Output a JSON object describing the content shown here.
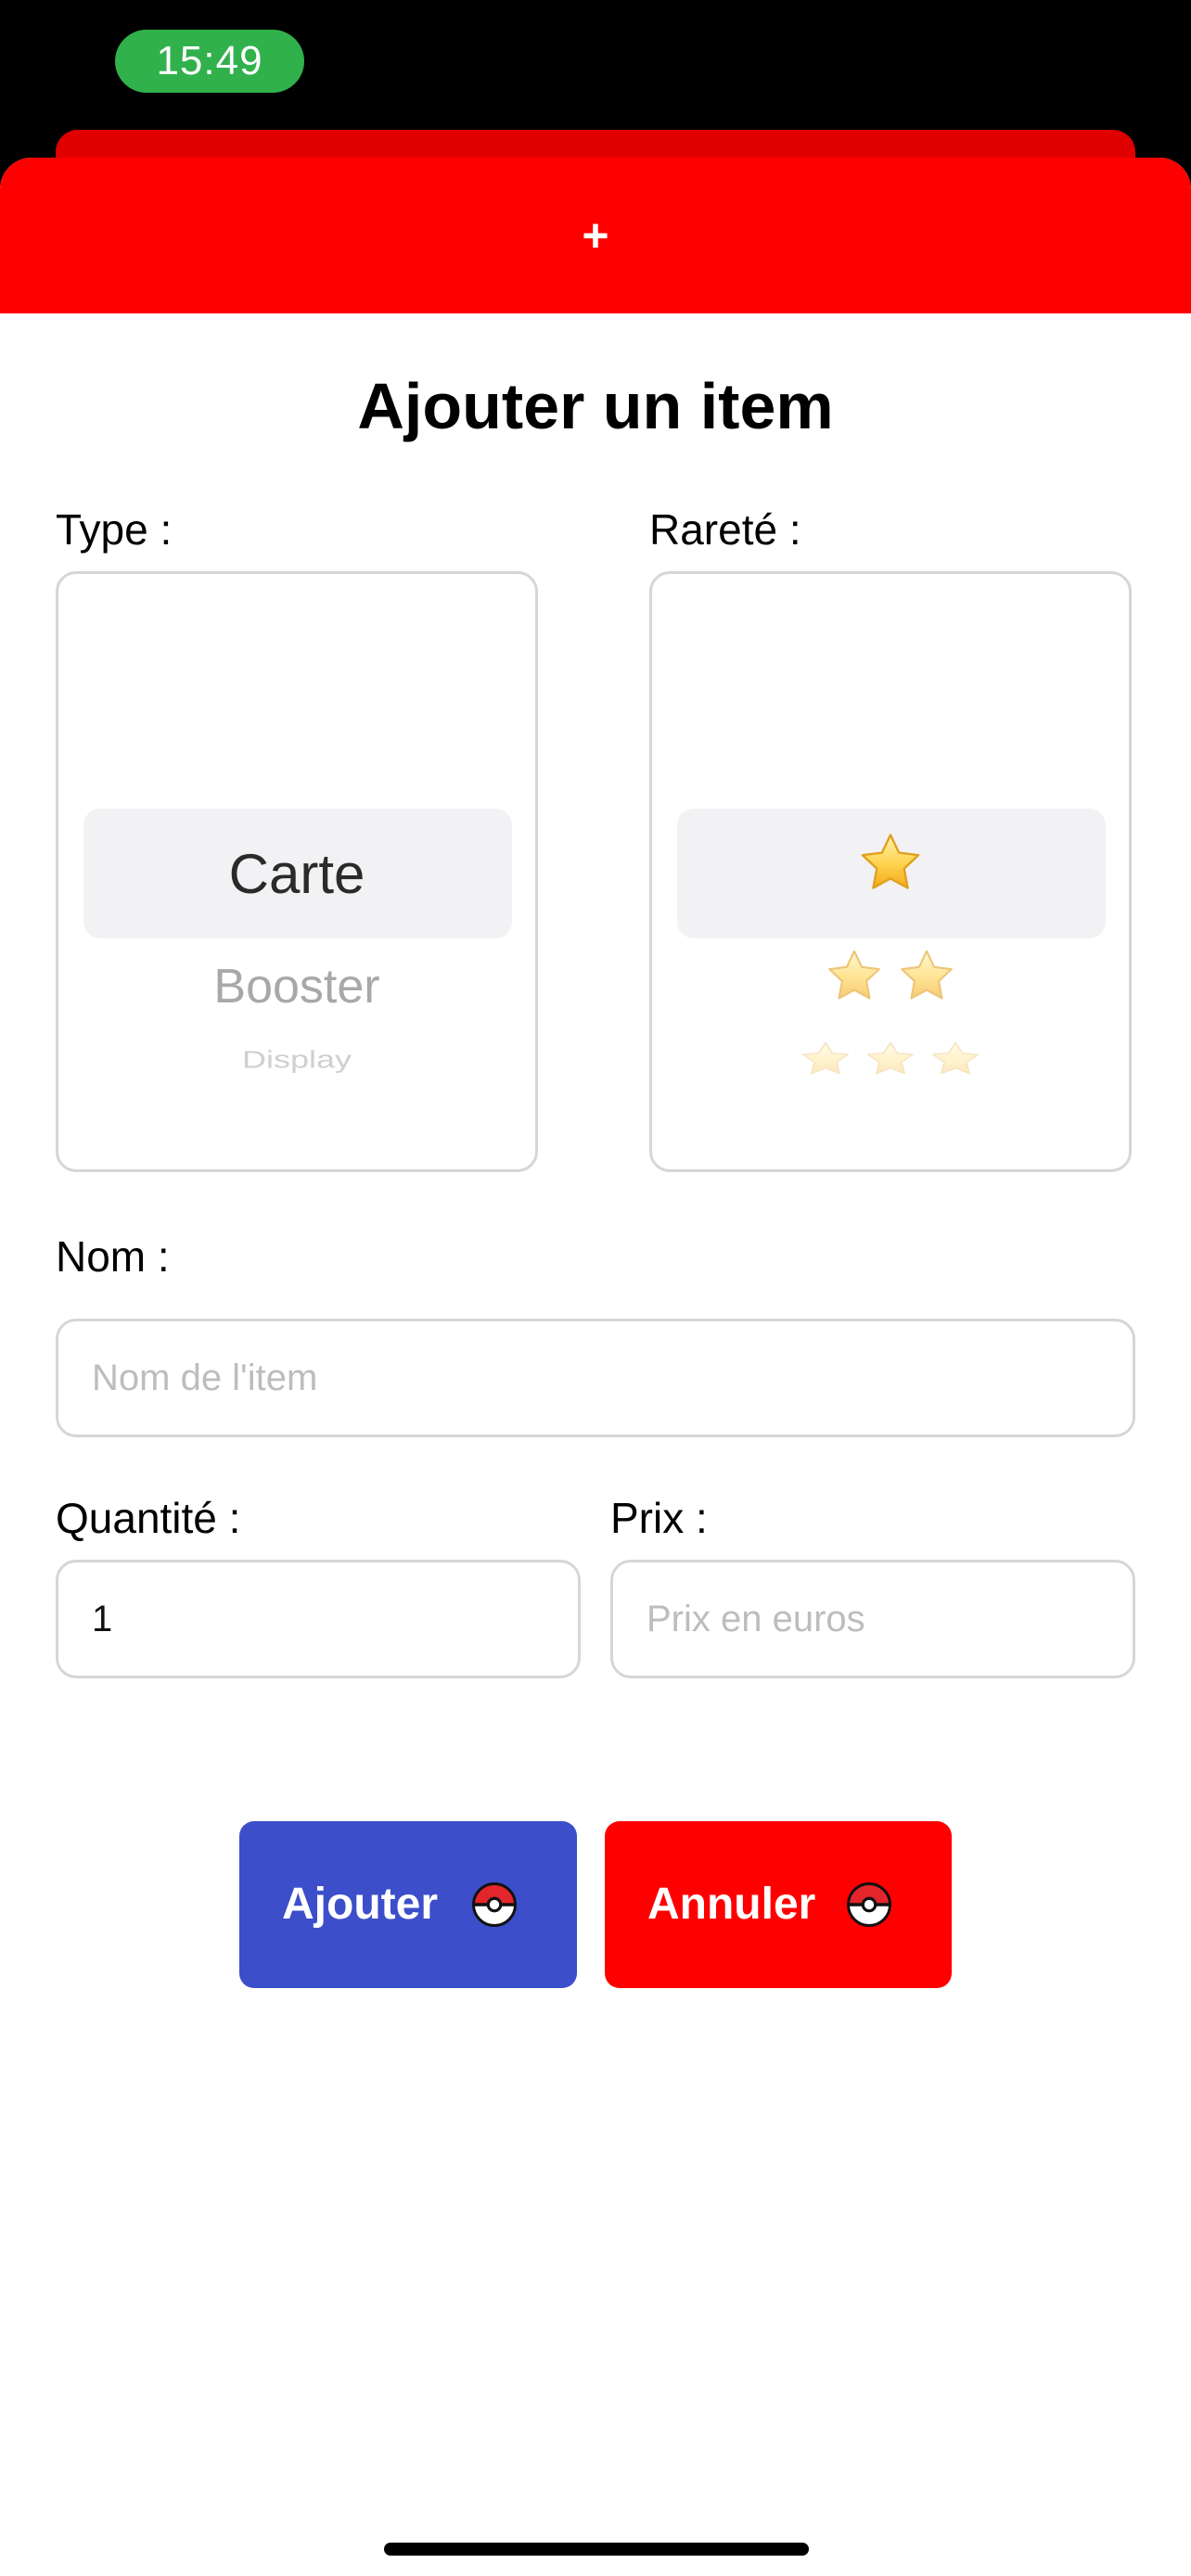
{
  "status_bar": {
    "time": "15:49",
    "time_pill_color": "#30b14c"
  },
  "header": {
    "color": "#ff0000",
    "plus_label": "+"
  },
  "form": {
    "title": "Ajouter un item",
    "type": {
      "label": "Type :",
      "options": [
        "Carte",
        "Booster",
        "Display"
      ],
      "selected": "Carte"
    },
    "rarity": {
      "label": "Rareté :",
      "options": [
        1,
        2,
        3
      ],
      "selected": 1,
      "icon": "star-icon"
    },
    "name": {
      "label": "Nom :",
      "value": "",
      "placeholder": "Nom de l'item"
    },
    "quantity": {
      "label": "Quantité :",
      "value": "1"
    },
    "price": {
      "label": "Prix :",
      "value": "",
      "placeholder": "Prix en euros"
    }
  },
  "actions": {
    "add": {
      "label": "Ajouter",
      "color": "#3c4ec9",
      "icon": "pokeball-icon"
    },
    "cancel": {
      "label": "Annuler",
      "color": "#ff0000",
      "icon": "pokeball-icon"
    }
  }
}
